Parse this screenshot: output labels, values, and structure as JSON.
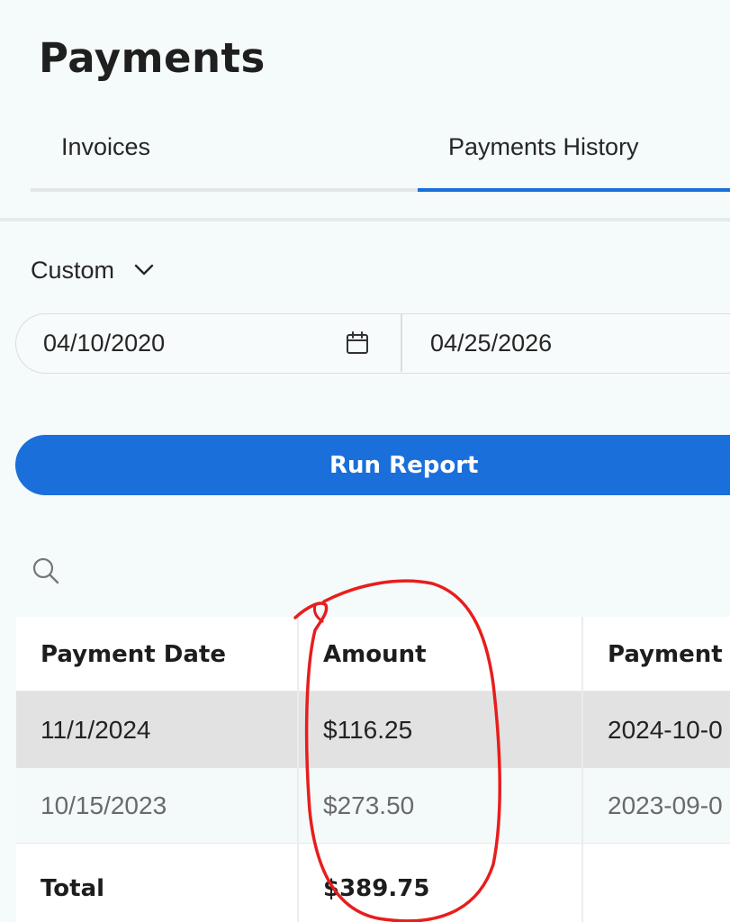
{
  "page": {
    "title": "Payments"
  },
  "tabs": [
    {
      "label": "Invoices",
      "active": false
    },
    {
      "label": "Payments History",
      "active": true
    }
  ],
  "filters": {
    "range_label": "Custom",
    "start_date": "04/10/2020",
    "end_date": "04/25/2026"
  },
  "actions": {
    "run_report": "Run Report"
  },
  "table": {
    "headers": [
      "Payment Date",
      "Amount",
      "Payment R"
    ],
    "rows": [
      {
        "date": "11/1/2024",
        "amount": "$116.25",
        "ref": "2024-10-0"
      },
      {
        "date": "10/15/2023",
        "amount": "$273.50",
        "ref": "2023-09-0"
      }
    ],
    "total": {
      "label": "Total",
      "amount": "$389.75"
    }
  },
  "colors": {
    "accent": "#1a6fdb",
    "annotation": "#e81d1d",
    "background": "#f5fafb",
    "row_highlight": "#e2e2e2"
  },
  "icons": {
    "range_dropdown": "chevron-down-icon",
    "date_picker": "calendar-icon",
    "search": "search-icon"
  }
}
